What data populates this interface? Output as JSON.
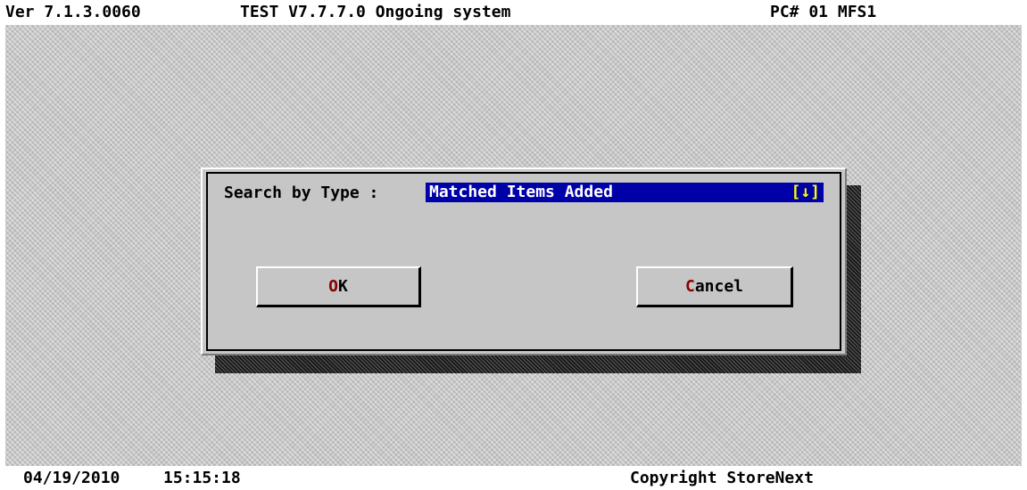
{
  "header": {
    "version": "Ver 7.1.3.0060",
    "system_name": "TEST V7.7.7.0 Ongoing system",
    "station": "PC# 01 MFS1"
  },
  "dialog": {
    "search_label": "Search by Type :",
    "search_value": "Matched Items Added",
    "dropdown_arrow": "[↓]",
    "ok_button": {
      "hotkey": "O",
      "rest": "K"
    },
    "cancel_button": {
      "hotkey": "C",
      "rest": "ancel"
    }
  },
  "footer": {
    "date": "04/19/2010",
    "time": "15:15:18",
    "copyright": "Copyright StoreNext"
  },
  "colors": {
    "selection_background": "#0000a8",
    "selection_text": "#ffffff",
    "dropdown_arrow": "#ffff00",
    "hotkey_letter": "#8b0000",
    "dialog_face": "#c6c6c6"
  },
  "icons": {
    "dropdown": "arrow-down-icon"
  }
}
